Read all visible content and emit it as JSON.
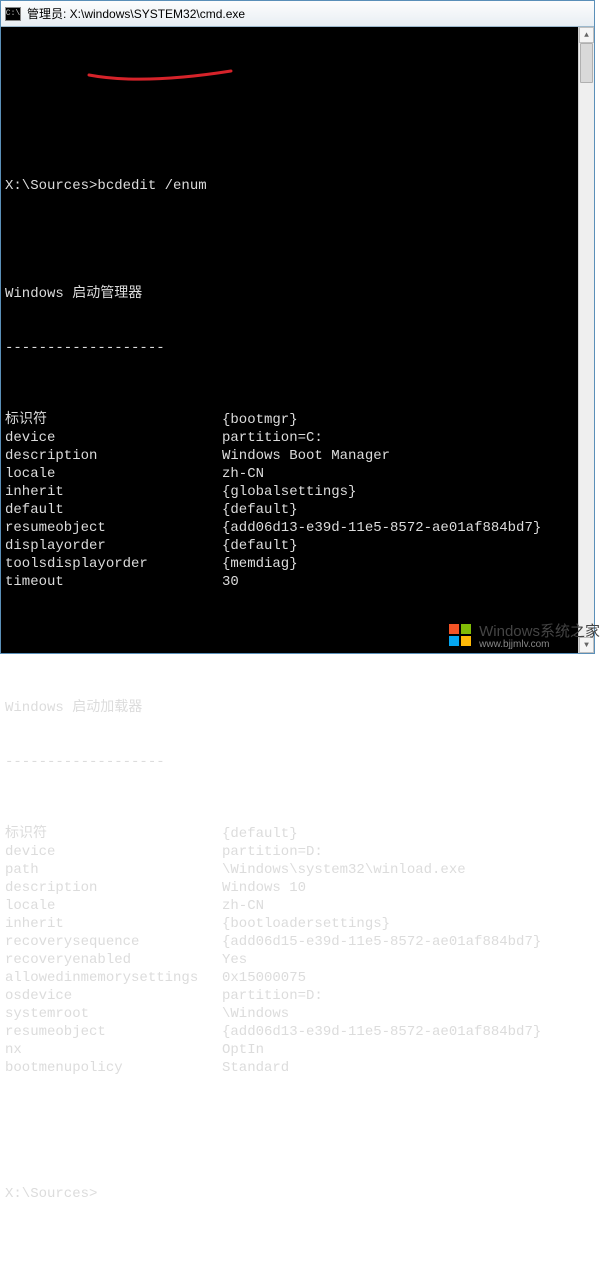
{
  "titlebar": {
    "icon_glyph": "C:\\",
    "title": "管理员: X:\\windows\\SYSTEM32\\cmd.exe"
  },
  "terminal": {
    "prompt1": "X:\\Sources>",
    "command": "bcdedit /enum",
    "section1_title": "Windows 启动管理器",
    "section1_hr": "-------------------",
    "section2_title": "Windows 启动加载器",
    "section2_hr": "-------------------",
    "prompt2": "X:\\Sources>",
    "bootmgr": [
      {
        "k": "标识符",
        "v": "{bootmgr}"
      },
      {
        "k": "device",
        "v": "partition=C:"
      },
      {
        "k": "description",
        "v": "Windows Boot Manager"
      },
      {
        "k": "locale",
        "v": "zh-CN"
      },
      {
        "k": "inherit",
        "v": "{globalsettings}"
      },
      {
        "k": "default",
        "v": "{default}"
      },
      {
        "k": "resumeobject",
        "v": "{add06d13-e39d-11e5-8572-ae01af884bd7}"
      },
      {
        "k": "displayorder",
        "v": "{default}"
      },
      {
        "k": "toolsdisplayorder",
        "v": "{memdiag}"
      },
      {
        "k": "timeout",
        "v": "30"
      }
    ],
    "loader": [
      {
        "k": "标识符",
        "v": "{default}"
      },
      {
        "k": "device",
        "v": "partition=D:"
      },
      {
        "k": "path",
        "v": "\\Windows\\system32\\winload.exe"
      },
      {
        "k": "description",
        "v": "Windows 10"
      },
      {
        "k": "locale",
        "v": "zh-CN"
      },
      {
        "k": "inherit",
        "v": "{bootloadersettings}"
      },
      {
        "k": "recoverysequence",
        "v": "{add06d15-e39d-11e5-8572-ae01af884bd7}"
      },
      {
        "k": "recoveryenabled",
        "v": "Yes"
      },
      {
        "k": "allowedinmemorysettings",
        "v": "0x15000075"
      },
      {
        "k": "osdevice",
        "v": "partition=D:"
      },
      {
        "k": "systemroot",
        "v": "\\Windows"
      },
      {
        "k": "resumeobject",
        "v": "{add06d13-e39d-11e5-8572-ae01af884bd7}"
      },
      {
        "k": "nx",
        "v": "OptIn"
      },
      {
        "k": "bootmenupolicy",
        "v": "Standard"
      }
    ]
  },
  "watermark": {
    "brand": "Windows",
    "subtitle": "系统之家",
    "url": "www.bjjmlv.com"
  },
  "annotation": {
    "color": "#d6232a"
  }
}
